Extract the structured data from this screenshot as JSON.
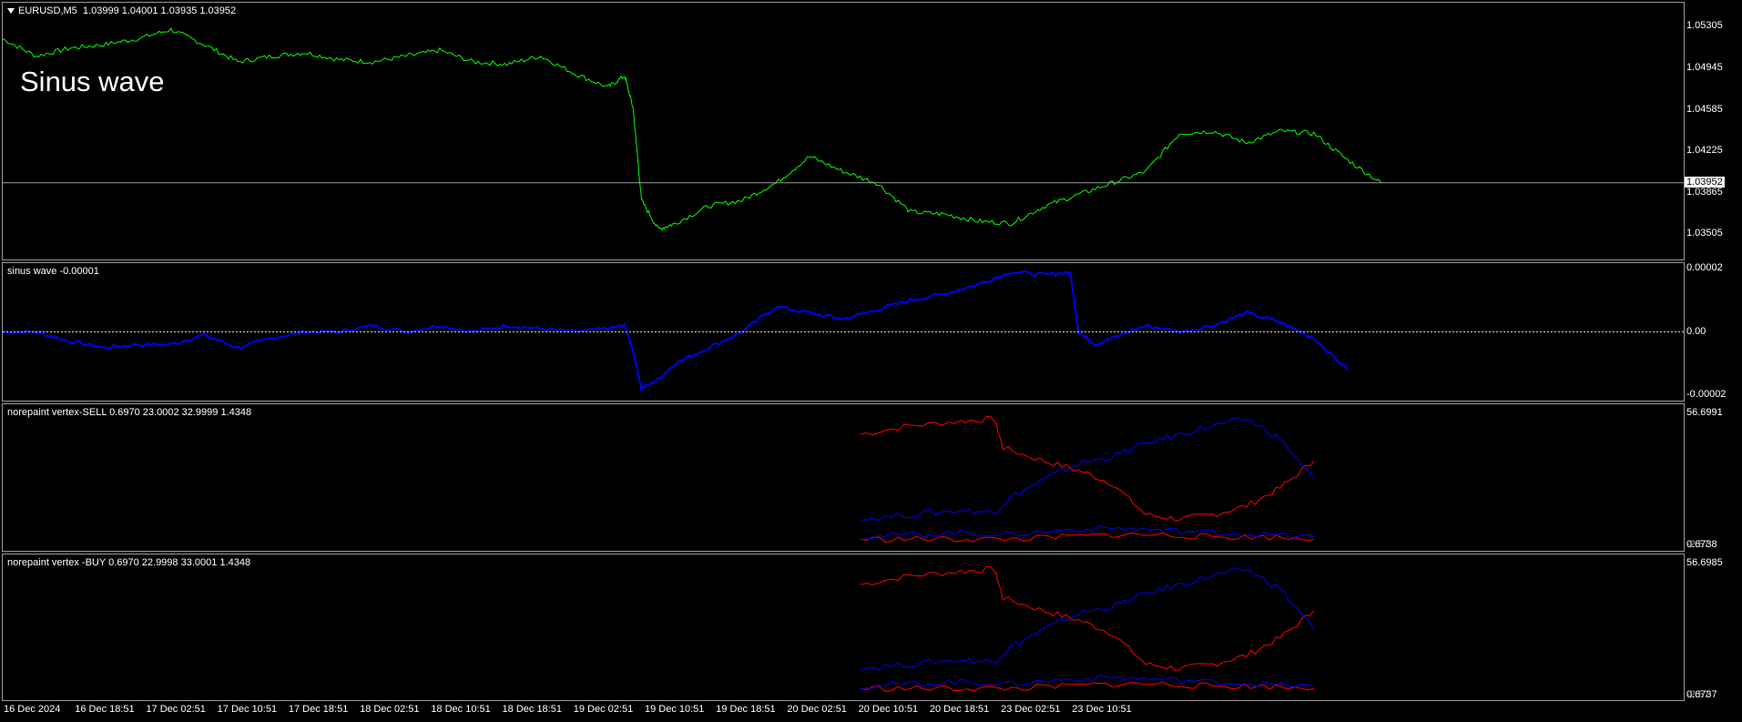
{
  "main_pane": {
    "symbol": "EURUSD,M5",
    "ohlc": "1.03999 1.04001 1.03935 1.03952",
    "overlay_text": "Sinus wave",
    "current_price": "1.03952",
    "price_labels": [
      "1.05305",
      "1.04945",
      "1.04585",
      "1.04225",
      "1.03865",
      "1.03505"
    ],
    "line_color": "#00ff00"
  },
  "sinus_pane": {
    "title": "sinus wave -0.00001",
    "scale_labels": [
      "0.00002",
      "0.00",
      "-0.00002"
    ],
    "line_color": "#0000ff"
  },
  "sell_pane": {
    "title": "norepaint vertex-SELL 0.6970 23.0002 32.9999 1.4348",
    "scale_top": "56.6991",
    "scale_bottom": "0.6738",
    "scale_bottom_overlap": "-2.57"
  },
  "buy_pane": {
    "title": "norepaint vertex -BUY 0.6970 22.9998 33.0001 1.4348",
    "scale_top": "56.6985",
    "scale_bottom": "0.6737",
    "scale_bottom_overlap": "-2.57"
  },
  "time_axis": [
    "16 Dec 2024",
    "16 Dec 18:51",
    "17 Dec 02:51",
    "17 Dec 10:51",
    "17 Dec 18:51",
    "18 Dec 02:51",
    "18 Dec 10:51",
    "18 Dec 18:51",
    "19 Dec 02:51",
    "19 Dec 10:51",
    "19 Dec 18:51",
    "20 Dec 02:51",
    "20 Dec 10:51",
    "20 Dec 18:51",
    "23 Dec 02:51",
    "23 Dec 10:51"
  ],
  "chart_data": [
    {
      "type": "line",
      "title": "EURUSD,M5",
      "ylim": [
        1.0335,
        1.0545
      ],
      "series": [
        {
          "name": "EURUSD,M5",
          "color": "#00ff00",
          "x": [
            0,
            0.02,
            0.04,
            0.06,
            0.08,
            0.1,
            0.12,
            0.14,
            0.16,
            0.18,
            0.2,
            0.22,
            0.24,
            0.26,
            0.28,
            0.3,
            0.32,
            0.34,
            0.36,
            0.37,
            0.375,
            0.38,
            0.39,
            0.4,
            0.42,
            0.44,
            0.46,
            0.48,
            0.5,
            0.52,
            0.54,
            0.56,
            0.58,
            0.6,
            0.62,
            0.64,
            0.66,
            0.68,
            0.7,
            0.72,
            0.74,
            0.76,
            0.78,
            0.8,
            0.82
          ],
          "values": [
            1.052,
            1.0505,
            1.0512,
            1.0515,
            1.052,
            1.0528,
            1.0515,
            1.05,
            1.0505,
            1.0508,
            1.0502,
            1.05,
            1.0505,
            1.051,
            1.05,
            1.0498,
            1.0505,
            1.049,
            1.0478,
            1.0488,
            1.046,
            1.038,
            1.0355,
            1.036,
            1.0375,
            1.038,
            1.0395,
            1.0418,
            1.0405,
            1.0395,
            1.037,
            1.0368,
            1.0362,
            1.036,
            1.0375,
            1.0385,
            1.0395,
            1.0405,
            1.0438,
            1.044,
            1.043,
            1.044,
            1.0438,
            1.0415,
            1.0395
          ]
        }
      ]
    },
    {
      "type": "line",
      "title": "sinus wave -0.00001",
      "ylim": [
        -2e-05,
        2e-05
      ],
      "series": [
        {
          "name": "sinus wave",
          "color": "#0000ff",
          "x": [
            0,
            0.02,
            0.04,
            0.06,
            0.08,
            0.1,
            0.12,
            0.14,
            0.16,
            0.18,
            0.2,
            0.22,
            0.24,
            0.26,
            0.28,
            0.3,
            0.32,
            0.34,
            0.36,
            0.37,
            0.375,
            0.38,
            0.39,
            0.4,
            0.42,
            0.44,
            0.46,
            0.48,
            0.5,
            0.52,
            0.54,
            0.56,
            0.58,
            0.6,
            0.62,
            0.635,
            0.64,
            0.65,
            0.66,
            0.68,
            0.7,
            0.72,
            0.74,
            0.76,
            0.78,
            0.8
          ],
          "values": [
            0.0,
            0.0,
            -3e-06,
            -5e-06,
            -4e-06,
            -4e-06,
            -1e-06,
            -5e-06,
            -2e-06,
            0.0,
            0.0,
            2e-06,
            0.0,
            2e-06,
            0.0,
            2e-06,
            1e-06,
            0.0,
            1e-06,
            2e-06,
            -6e-06,
            -1.8e-05,
            -1.5e-05,
            -1e-05,
            -5e-06,
            0.0,
            8e-06,
            6e-06,
            4e-06,
            7e-06,
            1e-05,
            1.2e-05,
            1.5e-05,
            1.9e-05,
            1.8e-05,
            1.9e-05,
            0.0,
            -4e-06,
            -2e-06,
            2e-06,
            0.0,
            2e-06,
            6e-06,
            3e-06,
            -2e-06,
            -1.2e-05
          ]
        }
      ]
    },
    {
      "type": "line",
      "title": "norepaint vertex-SELL 0.6970 23.0002 32.9999 1.4348",
      "ylim": [
        0.6738,
        56.6991
      ],
      "series": [
        {
          "color": "#ff0000",
          "x": [
            0.51,
            0.54,
            0.57,
            0.59,
            0.595,
            0.62,
            0.64,
            0.66,
            0.68,
            0.7,
            0.72,
            0.74,
            0.76,
            0.78
          ],
          "values": [
            48,
            52,
            54,
            55,
            42,
            36,
            32,
            26,
            12,
            10,
            12,
            16,
            24,
            36
          ]
        },
        {
          "color": "#0000ff",
          "x": [
            0.51,
            0.54,
            0.57,
            0.59,
            0.6,
            0.62,
            0.64,
            0.66,
            0.68,
            0.7,
            0.72,
            0.74,
            0.76,
            0.78
          ],
          "values": [
            10,
            12,
            14,
            13,
            20,
            28,
            35,
            38,
            44,
            48,
            52,
            55,
            46,
            28
          ]
        },
        {
          "color": "#ff0000",
          "x": [
            0.51,
            0.54,
            0.57,
            0.6,
            0.63,
            0.66,
            0.69,
            0.72,
            0.75,
            0.78
          ],
          "values": [
            1,
            1,
            1,
            1,
            2,
            3,
            3,
            2,
            2,
            1
          ]
        },
        {
          "color": "#0000ff",
          "x": [
            0.51,
            0.54,
            0.57,
            0.6,
            0.63,
            0.66,
            0.69,
            0.72,
            0.75,
            0.78
          ],
          "values": [
            2,
            3,
            4,
            3,
            5,
            6,
            5,
            4,
            3,
            2
          ]
        }
      ]
    },
    {
      "type": "line",
      "title": "norepaint vertex -BUY 0.6970 22.9998 33.0001 1.4348",
      "ylim": [
        0.6737,
        56.6985
      ],
      "series": [
        {
          "color": "#ff0000",
          "x": [
            0.51,
            0.54,
            0.57,
            0.59,
            0.595,
            0.62,
            0.64,
            0.66,
            0.68,
            0.7,
            0.72,
            0.74,
            0.76,
            0.78
          ],
          "values": [
            48,
            52,
            54,
            55,
            42,
            36,
            32,
            26,
            12,
            10,
            12,
            16,
            24,
            36
          ]
        },
        {
          "color": "#0000ff",
          "x": [
            0.51,
            0.54,
            0.57,
            0.59,
            0.6,
            0.62,
            0.64,
            0.66,
            0.68,
            0.7,
            0.72,
            0.74,
            0.76,
            0.78
          ],
          "values": [
            10,
            12,
            14,
            13,
            20,
            28,
            35,
            38,
            44,
            48,
            52,
            55,
            46,
            28
          ]
        },
        {
          "color": "#ff0000",
          "x": [
            0.51,
            0.54,
            0.57,
            0.6,
            0.63,
            0.66,
            0.69,
            0.72,
            0.75,
            0.78
          ],
          "values": [
            1,
            1,
            1,
            1,
            2,
            3,
            3,
            2,
            2,
            1
          ]
        },
        {
          "color": "#0000ff",
          "x": [
            0.51,
            0.54,
            0.57,
            0.6,
            0.63,
            0.66,
            0.69,
            0.72,
            0.75,
            0.78
          ],
          "values": [
            2,
            3,
            4,
            3,
            5,
            6,
            5,
            4,
            3,
            2
          ]
        }
      ]
    }
  ]
}
